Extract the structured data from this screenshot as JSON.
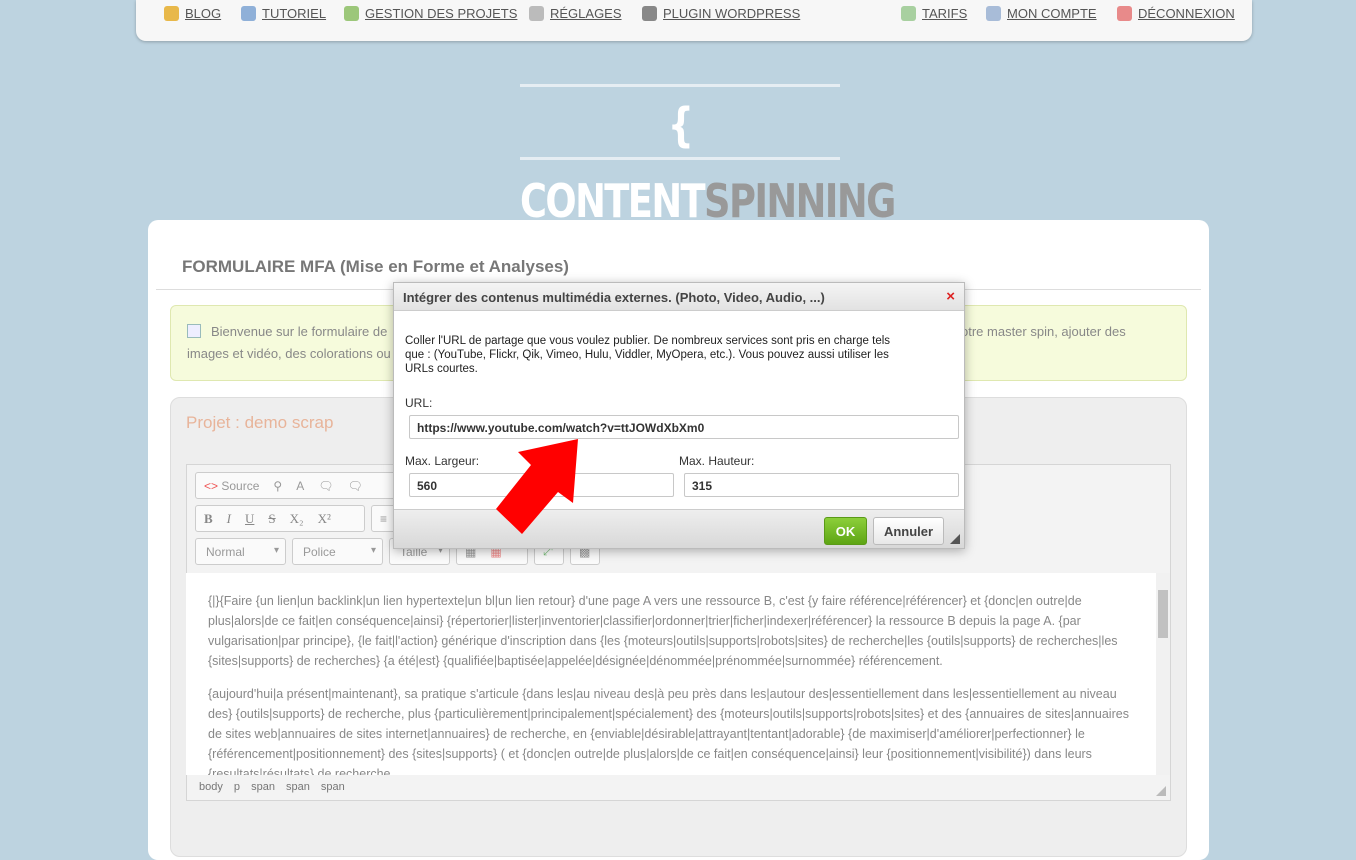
{
  "nav_left": [
    {
      "label": "BLOG",
      "icon": "pencil-icon",
      "color": "#e8b84a"
    },
    {
      "label": "TUTORIEL",
      "icon": "info-icon",
      "color": "#8fb0d8"
    },
    {
      "label": "GESTION DES PROJETS",
      "icon": "document-add-icon",
      "color": "#9cc77a"
    },
    {
      "label": "RÉGLAGES",
      "icon": "gear-icon",
      "color": "#bbbbbb"
    },
    {
      "label": "PLUGIN WORDPRESS",
      "icon": "wordpress-icon",
      "color": "#888888"
    }
  ],
  "nav_right": [
    {
      "label": "TARIFS",
      "icon": "calculator-icon",
      "color": "#a8d0a0"
    },
    {
      "label": "MON COMPTE",
      "icon": "id-card-icon",
      "color": "#a8bcd8"
    },
    {
      "label": "DÉCONNEXION",
      "icon": "close-icon",
      "color": "#e88a8a"
    }
  ],
  "logo": {
    "left": "{ CONTENT",
    "right": "SPINNING }"
  },
  "page_title": "FORMULAIRE MFA (Mise en Forme et Analyses)",
  "info": {
    "line1_left": "Bienvenue sur le formulaire de",
    "line1_right": "otre master spin, ajouter des",
    "line2_left": "images et vidéo, des colorations ou"
  },
  "project": "Projet : demo scrap",
  "toolbar": {
    "source": "Source",
    "format": "Normal",
    "font": "Police",
    "size": "Taille"
  },
  "content": {
    "p1": "{|}{Faire {un lien|un backlink|un lien hypertexte|un bl|un lien retour} d'une page A vers une ressource B, c'est {y faire référence|référencer} et {donc|en outre|de plus|alors|de ce fait|en conséquence|ainsi} {répertorier|lister|inventorier|classifier|ordonner|trier|ficher|indexer|référencer} la ressource B depuis la page A. {par vulgarisation|par principe}, {le fait|l'action} générique d'inscription dans {les {moteurs|outils|supports|robots|sites} de recherche|les {outils|supports} de recherches|les {sites|supports} de recherches} {a été|est} {qualifiée|baptisée|appelée|désignée|dénommée|prénommée|surnommée} référencement.",
    "p2": "{aujourd'hui|a présent|maintenant}, sa pratique s'articule {dans les|au niveau des|à peu près dans les|autour des|essentiellement dans les|essentiellement au niveau des} {outils|supports} de recherche, plus {particulièrement|principalement|spécialement} des {moteurs|outils|supports|robots|sites} et des {annuaires de sites|annuaires de sites web|annuaires de sites internet|annuaires} de recherche, en {enviable|désirable|attrayant|tentant|adorable} {de maximiser|d'améliorer|perfectionner} le {référencement|positionnement} des {sites|supports} ( et {donc|en outre|de plus|alors|de ce fait|en conséquence|ainsi} leur {positionnement|visibilité}) dans leurs {resultats|résultats} de recherche."
  },
  "statusbar": "body p span span span",
  "dialog": {
    "title": "Intégrer des contenus multimédia externes. (Photo, Video, Audio, ...)",
    "text": "Coller l'URL de partage que vous voulez publier. De nombreux services sont pris en charge tels que : (YouTube, Flickr, Qik, Vimeo, Hulu, Viddler, MyOpera, etc.). Vous pouvez aussi utiliser les URLs courtes.",
    "url_label": "URL:",
    "url_value": "https://www.youtube.com/watch?v=ttJOWdXbXm0",
    "width_label": "Max. Largeur:",
    "width_value": "560",
    "height_label": "Max. Hauteur:",
    "height_value": "315",
    "ok": "OK",
    "cancel": "Annuler"
  },
  "colors": {
    "ok_green": "#6db01d",
    "arrow": "#ff0000",
    "background": "#bdd3e0"
  }
}
